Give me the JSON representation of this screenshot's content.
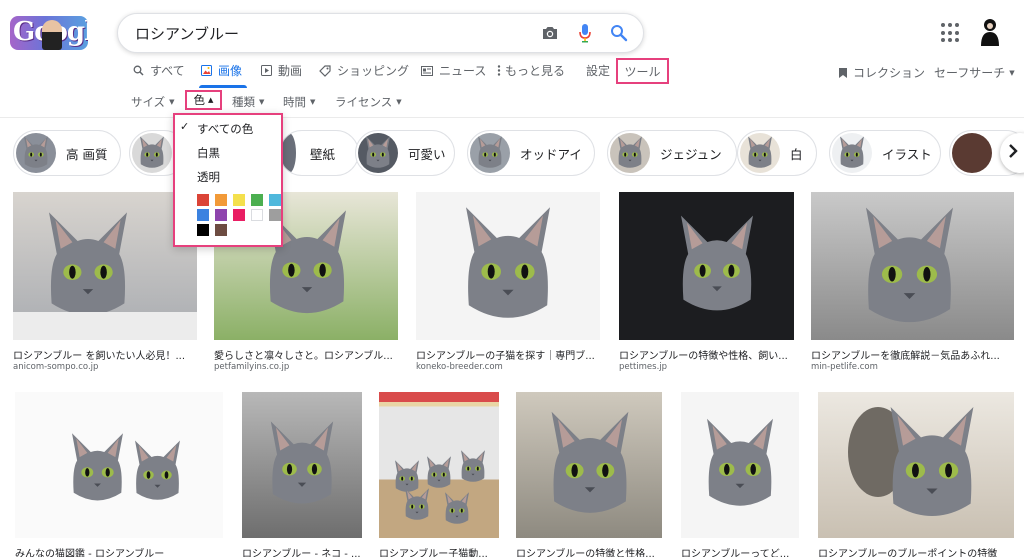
{
  "logo": {
    "text": "Google"
  },
  "search": {
    "query": "ロシアンブルー"
  },
  "tabs": [
    {
      "label": "すべて"
    },
    {
      "label": "画像"
    },
    {
      "label": "動画"
    },
    {
      "label": "ショッピング"
    },
    {
      "label": "ニュース"
    },
    {
      "label": "もっと見る"
    },
    {
      "label": "設定"
    },
    {
      "label": "ツール"
    }
  ],
  "right_nav": {
    "collection": "コレクション",
    "safesearch": "セーフサーチ"
  },
  "filters": [
    {
      "label": "サイズ"
    },
    {
      "label": "色"
    },
    {
      "label": "種類"
    },
    {
      "label": "時間"
    },
    {
      "label": "ライセンス"
    }
  ],
  "color_dropdown": {
    "items": [
      "すべての色",
      "白黒",
      "透明"
    ],
    "selected": "すべての色",
    "swatches": [
      "#db4437",
      "#f29a38",
      "#f4e04d",
      "#4caf50",
      "#4fb8dc",
      "#3b82e0",
      "#8e44ad",
      "#e91e63",
      "#ffffff",
      "#9e9e9e",
      "#000000",
      "#6d4c41"
    ]
  },
  "chips": [
    {
      "label": "高 画質"
    },
    {
      "label": ""
    },
    {
      "label": "壁紙"
    },
    {
      "label": "可愛い"
    },
    {
      "label": "オッドアイ"
    },
    {
      "label": "ジェジュン"
    },
    {
      "label": "白"
    },
    {
      "label": "イラスト"
    },
    {
      "label": ""
    }
  ],
  "results": [
    {
      "caption": "ロシアンブルー を飼いたい人必見！...",
      "domain": "anicom-sompo.co.jp"
    },
    {
      "caption": "愛らしさと凛々しさと。ロシアンブル...",
      "domain": "petfamilyins.co.jp"
    },
    {
      "caption": "ロシアンブルーの子猫を探す｜専門ブ...",
      "domain": "koneko-breeder.com"
    },
    {
      "caption": "ロシアンブルーの特徴や性格、飼い...",
      "domain": "pettimes.jp"
    },
    {
      "caption": "ロシアンブルーを徹底解説－気品あふれ...",
      "domain": "min-petlife.com"
    },
    {
      "caption": "みんなの猫図鑑 - ロシアンブルー",
      "domain": ""
    },
    {
      "caption": "ロシアンブルー - ネコ - ...",
      "domain": ""
    },
    {
      "caption": "ロシアンブルー子猫動...",
      "domain": ""
    },
    {
      "caption": "ロシアンブルーの特徴と性格...",
      "domain": ""
    },
    {
      "caption": "ロシアンブルーってど...",
      "domain": ""
    },
    {
      "caption": "ロシアンブルーのブルーポイントの特徴",
      "domain": ""
    }
  ],
  "colors": {
    "accent": "#1a73e8",
    "highlight": "#e6407d",
    "cat_gray": "#7b7f86"
  }
}
